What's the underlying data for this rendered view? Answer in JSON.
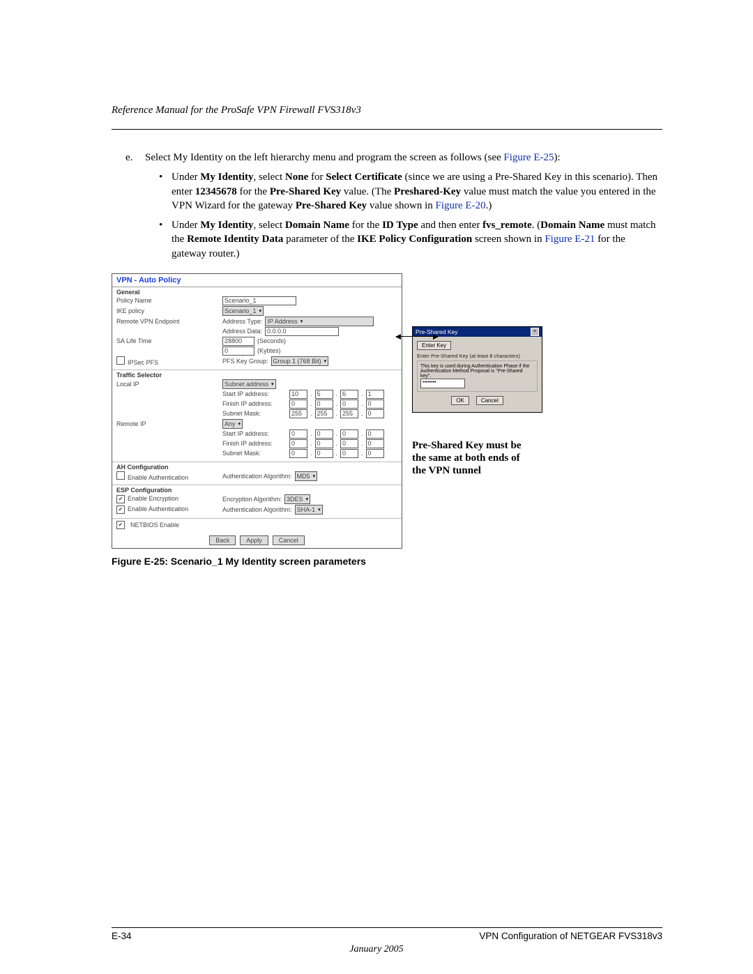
{
  "header": "Reference Manual for the ProSafe VPN Firewall FVS318v3",
  "step": {
    "marker": "e.",
    "text_pre": "Select My Identity on the left hierarchy menu and program the screen as follows (see ",
    "ref1": "Figure E-25",
    "text_post": "):"
  },
  "bullets": {
    "b1": {
      "pre": "Under ",
      "bold1": "My Identity",
      "mid1": ", select ",
      "bold2": "None",
      "mid2": " for ",
      "bold3": "Select Certificate",
      "mid3": " (since we are using a Pre-Shared Key in this scenario). Then enter ",
      "bold4": "12345678",
      "mid4": " for the ",
      "bold5": "Pre-Shared Key",
      "mid5": " value. (The ",
      "bold6": "Preshared-Key",
      "mid6": " value must match the value you entered in the VPN Wizard for the gateway ",
      "bold7": "Pre-Shared Key",
      "mid7": " value shown in ",
      "ref": "Figure E-20",
      "tail": ".)"
    },
    "b2": {
      "pre": "Under ",
      "bold1": "My Identity",
      "mid1": ", select ",
      "bold2": "Domain Name",
      "mid2": " for the ",
      "bold3": "ID Type",
      "mid3": " and then enter ",
      "bold4": "fvs_remote",
      "mid4": ". (",
      "bold5": "Domain Name",
      "mid5": " must match the ",
      "bold6": "Remote Identity Data",
      "mid6": " parameter of the ",
      "bold7": "IKE Policy Configuration",
      "mid7": " screen shown in ",
      "ref": "Figure E-21",
      "tail": " for the gateway router.)"
    }
  },
  "panel": {
    "title": "VPN - Auto Policy",
    "general": {
      "title": "General",
      "policy_name_lab": "Policy Name",
      "policy_name_val": "Scenario_1",
      "ike_policy_lab": "IKE policy",
      "ike_policy_val": "Scenario_1",
      "remote_vpn_lab": "Remote VPN Endpoint",
      "addr_type_lab": "Address Type:",
      "addr_type_val": "IP Address",
      "addr_data_lab": "Address Data:",
      "addr_data_val": "0.0.0.0",
      "sa_life_lab": "SA Life Time",
      "sa_sec_val": "28800",
      "sa_sec_unit": "(Seconds)",
      "sa_kb_val": "0",
      "sa_kb_unit": "(Kybtes)",
      "ipsec_pfs_lab": "IPSec PFS",
      "pfs_keygrp_lab": "PFS Key Group:",
      "pfs_keygrp_val": "Group 1 (768 Bit)"
    },
    "traffic": {
      "title": "Traffic Selector",
      "local_ip_lab": "Local IP",
      "local_sel": "Subnet address",
      "start_ip_lab": "Start IP address:",
      "local_start": [
        "10",
        "5",
        "6",
        "1"
      ],
      "finish_ip_lab": "Finish IP address:",
      "local_finish": [
        "0",
        "0",
        "0",
        "0"
      ],
      "subnet_lab": "Subnet Mask:",
      "local_mask": [
        "255",
        "255",
        "255",
        "0"
      ],
      "remote_ip_lab": "Remote IP",
      "remote_sel": "Any",
      "remote_start": [
        "0",
        "0",
        "0",
        "0"
      ],
      "remote_finish": [
        "0",
        "0",
        "0",
        "0"
      ],
      "remote_mask": [
        "0",
        "0",
        "0",
        "0"
      ]
    },
    "ah": {
      "title": "AH Configuration",
      "enable_lab": "Enable Authentication",
      "auth_alg_lab": "Authentication Algorithm:",
      "auth_alg_val": "MD5"
    },
    "esp": {
      "title": "ESP Configuration",
      "enc_lab": "Enable Encryption",
      "enc_alg_lab": "Encryption Algorithm:",
      "enc_alg_val": "3DES",
      "auth_lab": "Enable Authentication",
      "auth_alg_lab": "Authentication Algorithm:",
      "auth_alg_val": "SHA-1"
    },
    "netbios": "NETBIOS Enable",
    "buttons": {
      "back": "Back",
      "apply": "Apply",
      "cancel": "Cancel"
    }
  },
  "dialog": {
    "title": "Pre-Shared Key",
    "enter_key_btn": "Enter Key",
    "hint": "Enter Pre-Shared Key (at least 8 characters)",
    "sub_hint": "This key is used during Authentication Phase if the Authentication Method Proposal is \"Pre-Shared key\".",
    "value": "••••••••",
    "ok": "OK",
    "cancel": "Cancel"
  },
  "annotation": "Pre-Shared Key must be the same at both ends of the VPN tunnel",
  "figure_caption": "Figure E-25:  Scenario_1 My Identity screen parameters",
  "footer": {
    "left": "E-34",
    "right": "VPN Configuration of NETGEAR FVS318v3",
    "date": "January 2005"
  }
}
